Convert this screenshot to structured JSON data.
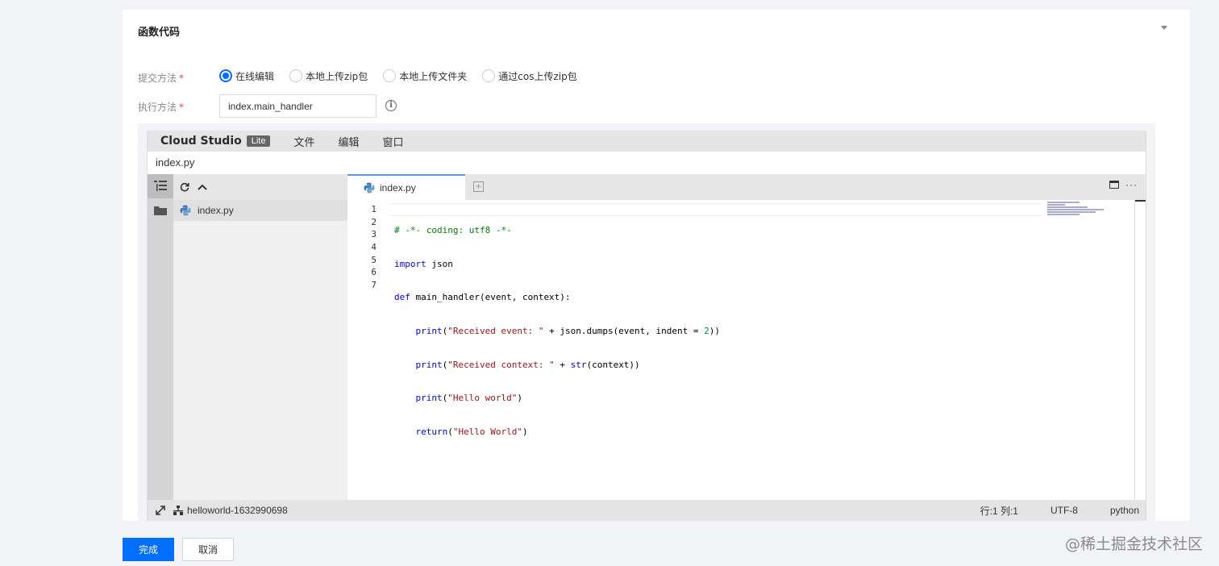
{
  "section": {
    "title": "函数代码"
  },
  "form": {
    "submit_label": "提交方法",
    "required_mark": "*",
    "submit_options": [
      "在线编辑",
      "本地上传zip包",
      "本地上传文件夹",
      "通过cos上传zip包"
    ],
    "selected_option": "在线编辑",
    "handler_label": "执行方法",
    "handler_value": "index.main_handler",
    "info_glyph": "i"
  },
  "ide": {
    "brand": "Cloud Studio",
    "badge": "Lite",
    "menu": [
      "文件",
      "编辑",
      "窗口"
    ],
    "file_title": "index.py",
    "explorer_file": "index.py",
    "tab_label": "index.py",
    "tab_add": "+",
    "more": "···",
    "line_numbers": [
      "1",
      "2",
      "3",
      "4",
      "5",
      "6",
      "7"
    ],
    "language": "python",
    "code": {
      "l1": "# -*- coding: utf8 -*-",
      "l2_kw": "import",
      "l2_rest": " json",
      "l3_kw": "def",
      "l3_rest": " main_handler(event, context):",
      "l4_fn": "print",
      "l4_a": "(",
      "l4_str": "\"Received event: \"",
      "l4_b": " + json.dumps(event, indent = ",
      "l4_num": "2",
      "l4_c": "))",
      "l5_fn": "print",
      "l5_a": "(",
      "l5_str": "\"Received context: \"",
      "l5_b": " + ",
      "l5_fn2": "str",
      "l5_c": "(context))",
      "l6_fn": "print",
      "l6_a": "(",
      "l6_str": "\"Hello world\"",
      "l6_c": ")",
      "l7_kw": "return",
      "l7_a": "(",
      "l7_str": "\"Hello World\"",
      "l7_c": ")"
    },
    "status": {
      "project": "helloworld-1632990698",
      "cursor": "行:1 列:1",
      "encoding": "UTF-8",
      "language": "python"
    }
  },
  "actions": {
    "confirm": "完成",
    "cancel": "取消"
  },
  "watermark": "@稀土掘金技术社区",
  "colors": {
    "primary": "#006eff",
    "ide_bar": "#e4e4e4"
  }
}
